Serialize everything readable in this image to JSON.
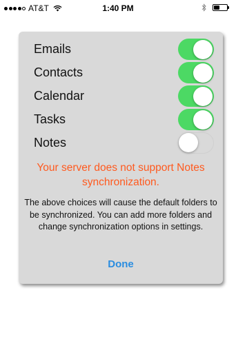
{
  "status_bar": {
    "carrier": "AT&T",
    "time": "1:40 PM",
    "signal_bars_filled": 4,
    "signal_bars_total": 5,
    "battery_level": 0.45,
    "icons": [
      "wifi-icon",
      "bluetooth-icon",
      "battery-icon"
    ]
  },
  "dialog": {
    "toggles": [
      {
        "label": "Emails",
        "on": true
      },
      {
        "label": "Contacts",
        "on": true
      },
      {
        "label": "Calendar",
        "on": true
      },
      {
        "label": "Tasks",
        "on": true
      },
      {
        "label": "Notes",
        "on": false
      }
    ],
    "warning": "Your server does not support Notes synchronization.",
    "info": "The above choices will cause the default folders to be synchronized. You can add more folders and change synchronization options in settings.",
    "done_label": "Done"
  },
  "colors": {
    "switch_on": "#4cd964",
    "warning_text": "#ff5a1f",
    "done_text": "#2a8de0",
    "dialog_background": "#d9d9d9"
  }
}
